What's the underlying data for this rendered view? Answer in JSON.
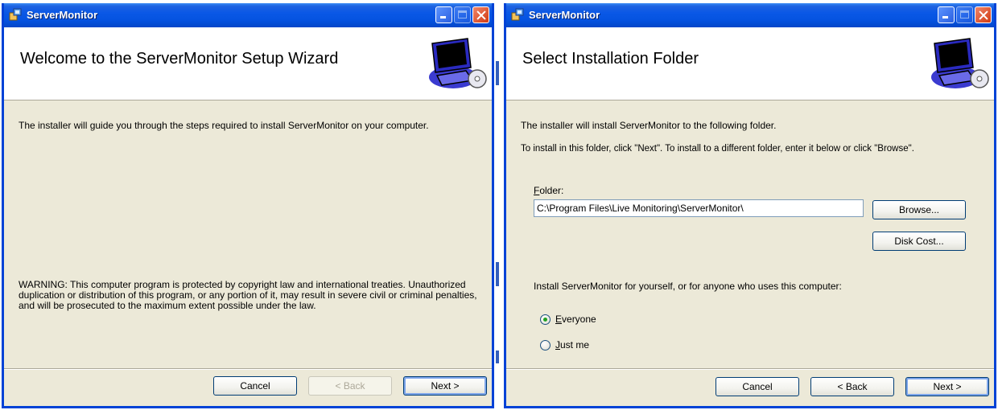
{
  "colors": {
    "titlebar": "#0553e0",
    "window_face": "#ece9d8",
    "border": "#0042d6",
    "radio_selected": "#21a121"
  },
  "left_window": {
    "title": "ServerMonitor",
    "heading": "Welcome to the ServerMonitor Setup Wizard",
    "intro": "The installer will guide you through the steps required to install ServerMonitor on your computer.",
    "warning": "WARNING: This computer program is protected by copyright law and international treaties. Unauthorized duplication or distribution of this program, or any portion of it, may result in severe civil or criminal penalties, and will be prosecuted to the maximum extent possible under the law.",
    "buttons": {
      "cancel": "Cancel",
      "back": "< Back",
      "next": "Next >"
    },
    "icons": {
      "app": "installer-icon",
      "banner": "computer-disc-icon"
    }
  },
  "right_window": {
    "title": "ServerMonitor",
    "heading": "Select Installation Folder",
    "line1": "The installer will install ServerMonitor to the following folder.",
    "line2": "To install in this folder, click \"Next\". To install to a different folder, enter it below or click \"Browse\".",
    "folder_label_first": "F",
    "folder_label_rest": "older:",
    "folder_value": "C:\\Program Files\\Live Monitoring\\ServerMonitor\\",
    "browse": "Browse...",
    "disk_cost": "Disk Cost...",
    "install_for": "Install ServerMonitor for yourself, or for anyone who uses this computer:",
    "options": [
      {
        "first": "E",
        "rest": "veryone",
        "selected": true
      },
      {
        "first": "J",
        "rest": "ust me",
        "selected": false
      }
    ],
    "buttons": {
      "cancel": "Cancel",
      "back": "< Back",
      "next": "Next >"
    }
  }
}
